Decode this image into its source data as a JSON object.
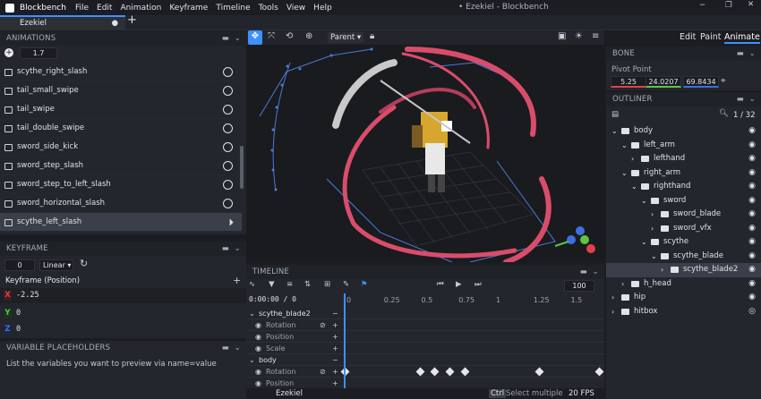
{
  "app": {
    "name": "Blockbench",
    "window_title": "• Ezekiel - Blockbench",
    "menu": [
      "File",
      "Edit",
      "Animation",
      "Keyframe",
      "Timeline",
      "Tools",
      "View",
      "Help"
    ]
  },
  "tabs": [
    {
      "label": "Ezekiel"
    }
  ],
  "modes": [
    "Edit",
    "Paint",
    "Animate"
  ],
  "animations": {
    "header": "ANIMATIONS",
    "length_value": "1.7",
    "items": [
      "scythe_right_slash",
      "tail_small_swipe",
      "tail_swipe",
      "tail_double_swipe",
      "sword_side_kick",
      "sword_step_slash",
      "sword_step_to_left_slash",
      "sword_horizontal_slash",
      "scythe_left_slash"
    ],
    "selected": "scythe_left_slash"
  },
  "keyframe": {
    "header": "KEYFRAME",
    "time": "0",
    "interpolation": "Linear",
    "channel_label": "Keyframe (Position)",
    "x": "-2.25",
    "y": "0",
    "z": "0"
  },
  "variables": {
    "header": "VARIABLE PLACEHOLDERS",
    "hint": "List the variables you want to preview via name=value"
  },
  "viewport": {
    "pivot_mode": "Parent"
  },
  "bone": {
    "header": "BONE",
    "pivot_label": "Pivot Point",
    "pivot": [
      "5.25",
      "24.0207",
      "69.8434"
    ]
  },
  "outliner": {
    "header": "OUTLINER",
    "count": "1 / 32",
    "items": [
      {
        "label": "body",
        "type": "folder",
        "depth": 0,
        "open": true
      },
      {
        "label": "left_arm",
        "type": "folder",
        "depth": 1,
        "open": true
      },
      {
        "label": "lefthand",
        "type": "folder",
        "depth": 2,
        "open": false
      },
      {
        "label": "right_arm",
        "type": "folder",
        "depth": 1,
        "open": true
      },
      {
        "label": "righthand",
        "type": "folder",
        "depth": 2,
        "open": true
      },
      {
        "label": "sword",
        "type": "folder",
        "depth": 3,
        "open": true
      },
      {
        "label": "sword_blade",
        "type": "folder",
        "depth": 4,
        "open": false
      },
      {
        "label": "sword_vfx",
        "type": "folder",
        "depth": 4,
        "open": false
      },
      {
        "label": "scythe",
        "type": "folder",
        "depth": 3,
        "open": true
      },
      {
        "label": "scythe_blade",
        "type": "folder",
        "depth": 4,
        "open": true
      },
      {
        "label": "scythe_blade2",
        "type": "folder",
        "depth": 5,
        "open": false,
        "selected": true
      },
      {
        "label": "h_head",
        "type": "folder",
        "depth": 1,
        "open": false
      },
      {
        "label": "hip",
        "type": "folder",
        "depth": 0,
        "open": false
      },
      {
        "label": "hitbox",
        "type": "folder",
        "depth": 0,
        "open": false,
        "hidden": true
      }
    ]
  },
  "timeline": {
    "header": "TIMELINE",
    "time": "0:00:00 / 0",
    "zoom": "100",
    "ticks": [
      "0",
      "0.25",
      "0.5",
      "0.75",
      "1",
      "1.25",
      "1.5"
    ],
    "groups": [
      {
        "name": "scythe_blade2",
        "channels": [
          "Rotation",
          "Position",
          "Scale"
        ]
      },
      {
        "name": "body",
        "channels": [
          "Rotation",
          "Position"
        ]
      }
    ],
    "rotation_keyframes": [
      0,
      0.5,
      0.6,
      0.7,
      0.8,
      1.3,
      1.7
    ]
  },
  "statusbar": {
    "model": "Ezekiel",
    "key": "Ctrl",
    "hint": "Select multiple",
    "fps": "20 FPS"
  },
  "colors": {
    "accent": "#3e90ff",
    "background": "#1b1d23",
    "panel": "#23262c",
    "trail": "#d94d6b",
    "gizmo": "#4a7bd6",
    "axis_x": "#e0404e",
    "axis_y": "#5ec444",
    "axis_z": "#3e6fe0"
  }
}
